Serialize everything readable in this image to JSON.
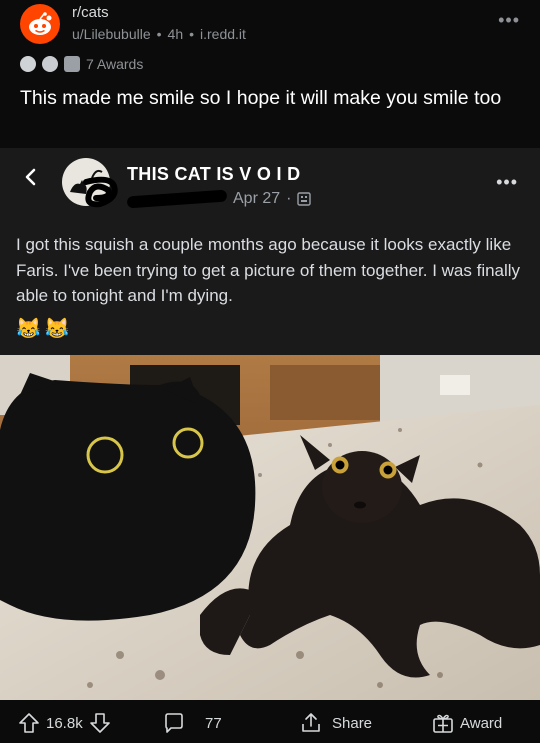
{
  "post": {
    "subreddit": "r/cats",
    "author": "u/Lilebubulle",
    "time": "4h",
    "domain": "i.redd.it",
    "dot": "•",
    "awards_label": "7 Awards",
    "title": "This made me smile so I hope it will make you smile too"
  },
  "embed": {
    "display_name": "THIS CAT IS V O I D",
    "date": "Apr 27",
    "dot": "·",
    "body": "I got this squish a couple months ago because it looks exactly like Faris. I've been trying to get a picture of them together. I was finally able to tonight and I'm dying.",
    "emojis": [
      "😹",
      "😹"
    ]
  },
  "actions": {
    "score": "16.8k",
    "comments": "77",
    "share_label": "Share",
    "award_label": "Award"
  },
  "icons": [
    "reddit-alien-icon",
    "more-icon",
    "award-icon",
    "back-chevron-icon",
    "image-icon",
    "upvote-icon",
    "downvote-icon",
    "comment-icon",
    "share-icon",
    "gift-award-icon"
  ],
  "colors": {
    "subreddit_orange": "#ff4500",
    "background": "#0b0b0b",
    "embed_bg": "#1a1a1b"
  }
}
